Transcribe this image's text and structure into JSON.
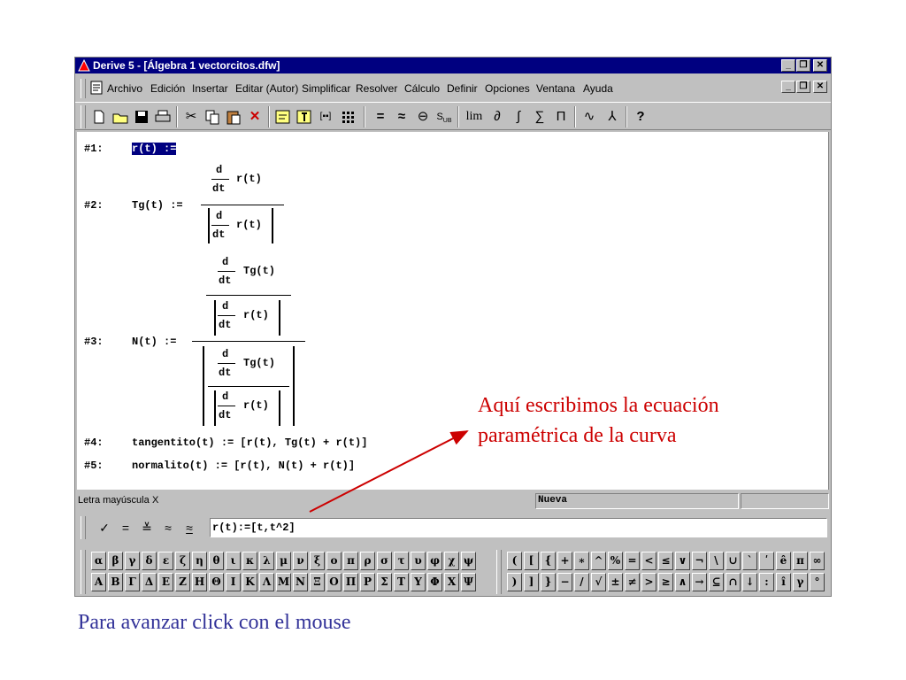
{
  "window": {
    "title": "Derive 5 - [Álgebra 1  vectorcitos.dfw]",
    "colors": {
      "titlebar": "#000080",
      "selection": "#000080"
    },
    "controls": [
      "_",
      "❐",
      "✕"
    ]
  },
  "menu": [
    "Archivo",
    "Edición",
    "Insertar",
    "Editar (Autor)",
    "Simplificar",
    "Resolver",
    "Cálculo",
    "Definir",
    "Opciones",
    "Ventana",
    "Ayuda"
  ],
  "toolbar": {
    "icons": [
      "new-document-icon",
      "open-folder-icon",
      "save-icon",
      "print-icon",
      "cut-icon",
      "copy-icon",
      "paste-icon",
      "delete-icon",
      "author-expression-icon",
      "author-text-icon",
      "author-vector-icon",
      "author-matrix-icon",
      "simplify-icon",
      "approximate-icon",
      "solve-icon",
      "substitute-icon",
      "limit-icon",
      "differentiate-icon",
      "integrate-icon",
      "sum-icon",
      "product-icon",
      "2d-plot-icon",
      "3d-plot-icon",
      "help-icon"
    ],
    "labels": {
      "lim": "lim",
      "sum": "∑",
      "prod": "Π",
      "int": "∫",
      "diff": "∂",
      "sub": "S",
      "sub_small": "UB"
    }
  },
  "expressions": {
    "e1_label": "#1:",
    "e1_expr": "r(t) :=",
    "e2_label": "#2:",
    "e2_lhs": "Tg(t) :=",
    "e3_label": "#3:",
    "e3_lhs": "N(t) :=",
    "e4_label": "#4:",
    "e4_expr": "tangentito(t) := [r(t), Tg(t) + r(t)]",
    "e5_label": "#5:",
    "e5_expr": "normalito(t) := [r(t), N(t) + r(t)]",
    "d": "d",
    "dt": "dt",
    "r": "r(t)",
    "tg": "Tg(t)"
  },
  "status": {
    "left": "Letra mayúscula",
    "x": "X",
    "mode": "Nueva"
  },
  "entry": {
    "value": "r(t):=[t,t^2]",
    "buttons": [
      "✓",
      "=",
      "≚",
      "≈",
      "≈"
    ]
  },
  "greek": {
    "row1": [
      "α",
      "β",
      "γ",
      "δ",
      "ε",
      "ζ",
      "η",
      "θ",
      "ι",
      "κ",
      "λ",
      "μ",
      "ν",
      "ξ",
      "ο",
      "π",
      "ρ",
      "σ",
      "τ",
      "υ",
      "φ",
      "χ",
      "ψ"
    ],
    "row2": [
      "Α",
      "Β",
      "Γ",
      "Δ",
      "Ε",
      "Ζ",
      "Η",
      "Θ",
      "Ι",
      "Κ",
      "Λ",
      "Μ",
      "Ν",
      "Ξ",
      "Ο",
      "Π",
      "Ρ",
      "Σ",
      "Τ",
      "Υ",
      "Φ",
      "Χ",
      "Ψ"
    ]
  },
  "math_symbols": {
    "row1": [
      "(",
      "[",
      "{",
      "+",
      "∗",
      "^",
      "%",
      "=",
      "<",
      "≤",
      "∨",
      "¬",
      "\\",
      "∪",
      "`",
      "ʹ",
      "ê",
      "π",
      "∞"
    ],
    "row2": [
      ")",
      "]",
      "}",
      "−",
      "/",
      "√",
      "±",
      "≠",
      ">",
      "≥",
      "∧",
      "→",
      "⊆",
      "∩",
      "↓",
      ":",
      "î",
      "γ",
      "°"
    ]
  },
  "annotation": {
    "line1": "Aquí escribimos la ecuación",
    "line2": "paramétrica de la curva",
    "color": "#cc0000"
  },
  "footer": {
    "text": "Para avanzar click con el mouse",
    "color": "#333399"
  }
}
